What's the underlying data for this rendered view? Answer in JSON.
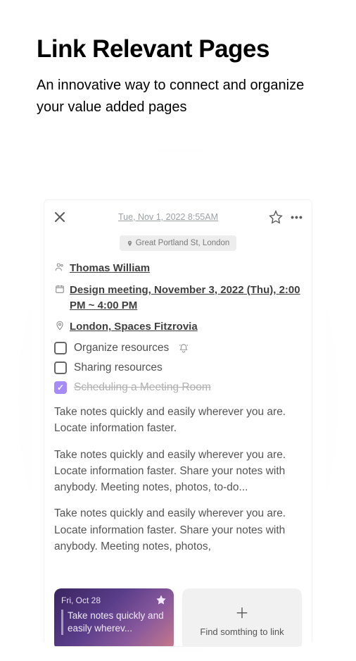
{
  "hero": {
    "title": "Link Relevant Pages",
    "subtitle": "An innovative way to connect and organize your value added pages"
  },
  "note": {
    "timestamp": "Tue, Nov 1, 2022 8:55AM",
    "location_tag": "Great Portland St, London",
    "person": "Thomas William",
    "event": "Design meeting, November 3, 2022 (Thu), 2:00 PM ~ 4:00 PM",
    "place": "London, Spaces Fitzrovia",
    "tasks": [
      {
        "label": "Organize resources",
        "checked": false,
        "bell": true
      },
      {
        "label": "Sharing resources",
        "checked": false,
        "bell": false
      },
      {
        "label": "Scheduling a Meeting Room",
        "checked": true,
        "bell": false
      }
    ],
    "paragraphs": [
      "Take notes quickly and easily wherever you are. Locate information faster.",
      "Take notes quickly and easily wherever you are. Locate information faster. Share your notes with anybody. Meeting notes, photos, to-do...",
      "Take notes quickly and easily wherever you are. Locate information faster. Share your notes with anybody. Meeting notes, photos,"
    ]
  },
  "linked": {
    "card1_date": "Fri, Oct 28",
    "card1_text": "Take notes quickly and easily wherev...",
    "card2_text": "Find somthing to link"
  }
}
